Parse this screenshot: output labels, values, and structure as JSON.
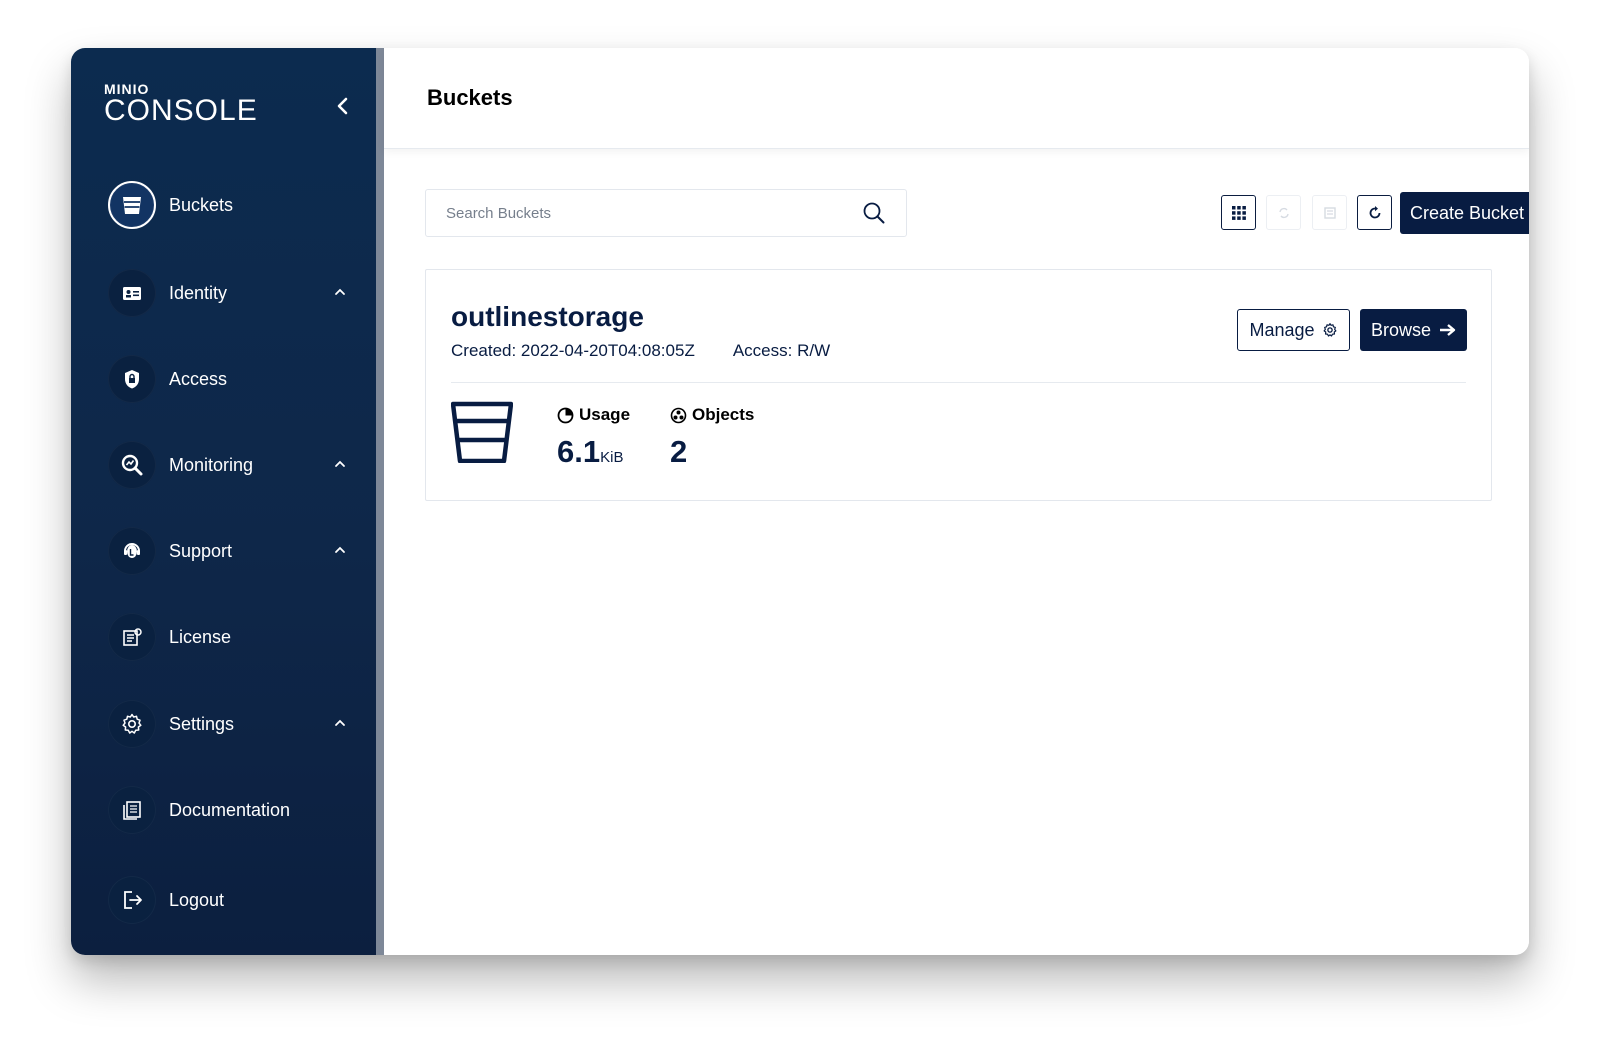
{
  "app": {
    "logo_small": "MINIO",
    "logo_big": "CONSOLE"
  },
  "sidebar": {
    "items": [
      {
        "label": "Buckets",
        "icon": "bucket-icon",
        "active": true,
        "expandable": false
      },
      {
        "label": "Identity",
        "icon": "id-card-icon",
        "active": false,
        "expandable": true
      },
      {
        "label": "Access",
        "icon": "lock-shield-icon",
        "active": false,
        "expandable": false
      },
      {
        "label": "Monitoring",
        "icon": "magnifier-chart-icon",
        "active": false,
        "expandable": true
      },
      {
        "label": "Support",
        "icon": "support-agent-icon",
        "active": false,
        "expandable": true
      },
      {
        "label": "License",
        "icon": "license-document-icon",
        "active": false,
        "expandable": false
      },
      {
        "label": "Settings",
        "icon": "gear-icon",
        "active": false,
        "expandable": true
      },
      {
        "label": "Documentation",
        "icon": "documentation-icon",
        "active": false,
        "expandable": false
      },
      {
        "label": "Logout",
        "icon": "logout-icon",
        "active": false,
        "expandable": false
      }
    ]
  },
  "header": {
    "title": "Buckets"
  },
  "toolbar": {
    "search_placeholder": "Search Buckets",
    "create_label": "Create Bucket"
  },
  "bucket": {
    "name": "outlinestorage",
    "created": "Created: 2022-04-20T04:08:05Z",
    "access": "Access: R/W",
    "manage_label": "Manage",
    "browse_label": "Browse",
    "usage_label": "Usage",
    "usage_value": "6.1",
    "usage_unit": "KiB",
    "objects_label": "Objects",
    "objects_value": "2"
  },
  "colors": {
    "sidebar_bg": "#0c2b4f",
    "primary": "#081c42",
    "border": "#e3e7ed"
  }
}
